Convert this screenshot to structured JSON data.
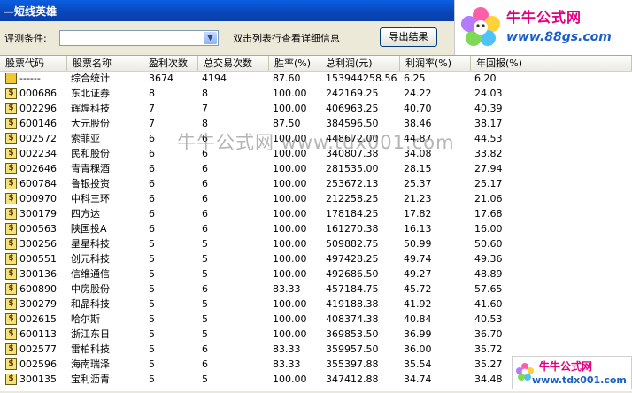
{
  "window": {
    "title": "—短线英雄"
  },
  "controls": {
    "condition_label": "评测条件:",
    "condition_value": "",
    "hint": "双击列表行查看详细信息",
    "export_button": "导出结果"
  },
  "logo": {
    "brand": "牛牛公式网",
    "url": "www.88gs.com"
  },
  "watermark": {
    "text": "牛牛公式网 www.tdx001.com"
  },
  "watermark_logo": {
    "brand": "牛牛公式网",
    "url": "www.tdx001.com"
  },
  "columns": [
    "股票代码",
    "股票名称",
    "盈利次数",
    "总交易次数",
    "胜率(%)",
    "总利润(元)",
    "利润率(%)",
    "年回报(%)"
  ],
  "rows": [
    {
      "code": "------",
      "name": "综合统计",
      "wins": "3674",
      "trades": "4194",
      "rate": "87.60",
      "profit": "153944258.56",
      "margin": "6.25",
      "annual": "6.20",
      "summary": true
    },
    {
      "code": "000686",
      "name": "东北证券",
      "wins": "8",
      "trades": "8",
      "rate": "100.00",
      "profit": "242169.25",
      "margin": "24.22",
      "annual": "24.03"
    },
    {
      "code": "002296",
      "name": "辉煌科技",
      "wins": "7",
      "trades": "7",
      "rate": "100.00",
      "profit": "406963.25",
      "margin": "40.70",
      "annual": "40.39"
    },
    {
      "code": "600146",
      "name": "大元股份",
      "wins": "7",
      "trades": "8",
      "rate": "87.50",
      "profit": "384596.50",
      "margin": "38.46",
      "annual": "38.17"
    },
    {
      "code": "002572",
      "name": "索菲亚",
      "wins": "6",
      "trades": "6",
      "rate": "100.00",
      "profit": "448672.00",
      "margin": "44.87",
      "annual": "44.53"
    },
    {
      "code": "002234",
      "name": "民和股份",
      "wins": "6",
      "trades": "6",
      "rate": "100.00",
      "profit": "340807.38",
      "margin": "34.08",
      "annual": "33.82"
    },
    {
      "code": "002646",
      "name": "青青稞酒",
      "wins": "6",
      "trades": "6",
      "rate": "100.00",
      "profit": "281535.00",
      "margin": "28.15",
      "annual": "27.94"
    },
    {
      "code": "600784",
      "name": "鲁银投资",
      "wins": "6",
      "trades": "6",
      "rate": "100.00",
      "profit": "253672.13",
      "margin": "25.37",
      "annual": "25.17"
    },
    {
      "code": "000970",
      "name": "中科三环",
      "wins": "6",
      "trades": "6",
      "rate": "100.00",
      "profit": "212258.25",
      "margin": "21.23",
      "annual": "21.06"
    },
    {
      "code": "300179",
      "name": "四方达",
      "wins": "6",
      "trades": "6",
      "rate": "100.00",
      "profit": "178184.25",
      "margin": "17.82",
      "annual": "17.68"
    },
    {
      "code": "000563",
      "name": "陕国投A",
      "wins": "6",
      "trades": "6",
      "rate": "100.00",
      "profit": "161270.38",
      "margin": "16.13",
      "annual": "16.00"
    },
    {
      "code": "300256",
      "name": "星星科技",
      "wins": "5",
      "trades": "5",
      "rate": "100.00",
      "profit": "509882.75",
      "margin": "50.99",
      "annual": "50.60"
    },
    {
      "code": "000551",
      "name": "创元科技",
      "wins": "5",
      "trades": "5",
      "rate": "100.00",
      "profit": "497428.25",
      "margin": "49.74",
      "annual": "49.36"
    },
    {
      "code": "300136",
      "name": "信维通信",
      "wins": "5",
      "trades": "5",
      "rate": "100.00",
      "profit": "492686.50",
      "margin": "49.27",
      "annual": "48.89"
    },
    {
      "code": "600890",
      "name": "中房股份",
      "wins": "5",
      "trades": "6",
      "rate": "83.33",
      "profit": "457184.75",
      "margin": "45.72",
      "annual": "57.65"
    },
    {
      "code": "300279",
      "name": "和晶科技",
      "wins": "5",
      "trades": "5",
      "rate": "100.00",
      "profit": "419188.38",
      "margin": "41.92",
      "annual": "41.60"
    },
    {
      "code": "002615",
      "name": "哈尔斯",
      "wins": "5",
      "trades": "5",
      "rate": "100.00",
      "profit": "408374.38",
      "margin": "40.84",
      "annual": "40.53"
    },
    {
      "code": "600113",
      "name": "浙江东日",
      "wins": "5",
      "trades": "5",
      "rate": "100.00",
      "profit": "369853.50",
      "margin": "36.99",
      "annual": "36.70"
    },
    {
      "code": "002577",
      "name": "雷柏科技",
      "wins": "5",
      "trades": "6",
      "rate": "83.33",
      "profit": "359957.50",
      "margin": "36.00",
      "annual": "35.72"
    },
    {
      "code": "002596",
      "name": "海南瑞泽",
      "wins": "5",
      "trades": "6",
      "rate": "83.33",
      "profit": "355397.88",
      "margin": "35.54",
      "annual": "35.27"
    },
    {
      "code": "300135",
      "name": "宝利沥青",
      "wins": "5",
      "trades": "5",
      "rate": "100.00",
      "profit": "347412.88",
      "margin": "34.74",
      "annual": "34.48"
    }
  ]
}
